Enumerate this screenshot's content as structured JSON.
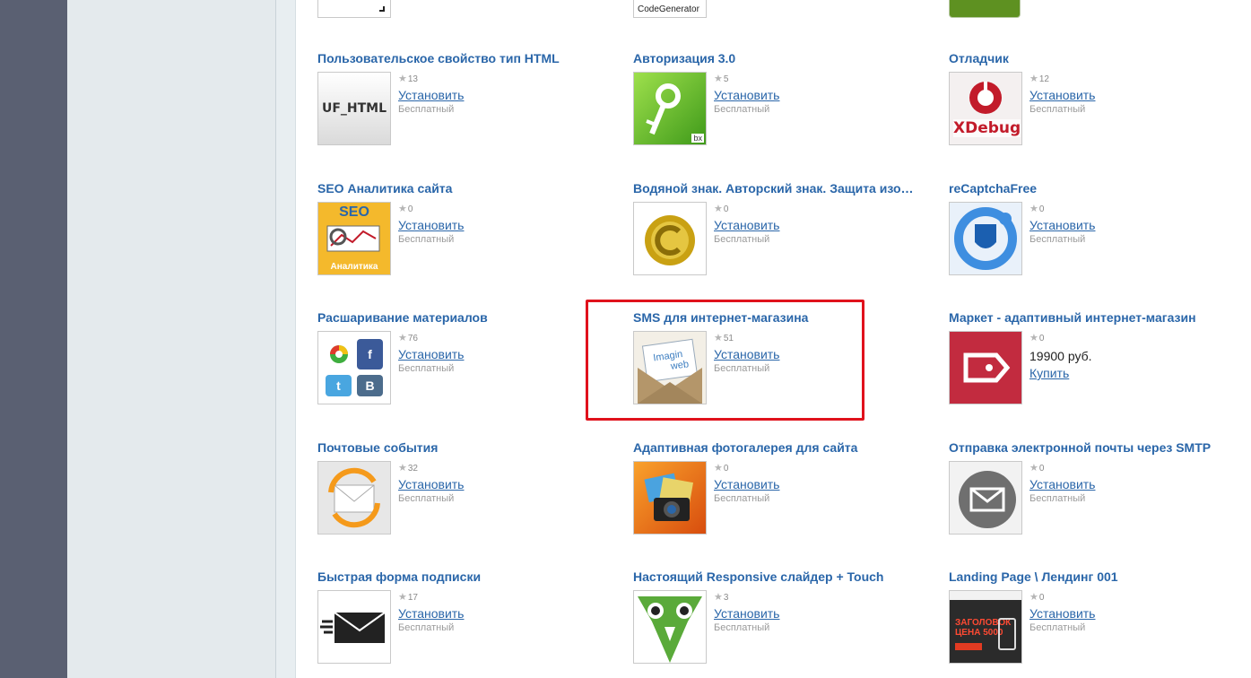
{
  "top_partial": {
    "codegen_label": "CodeGenerator"
  },
  "modules": [
    {
      "title": "Пользовательское свойство тип HTML",
      "rating": "13",
      "action": "Установить",
      "price": "Бесплатный",
      "thumb_text": "UF_HTML"
    },
    {
      "title": "Авторизация 3.0",
      "rating": "5",
      "action": "Установить",
      "price": "Бесплатный",
      "thumb_text": "bx"
    },
    {
      "title": "Отладчик",
      "rating": "12",
      "action": "Установить",
      "price": "Бесплатный",
      "thumb_text": "XDebug"
    },
    {
      "title": "SEO Аналитика сайта",
      "rating": "0",
      "action": "Установить",
      "price": "Бесплатный",
      "thumb_text": "SEO",
      "thumb_subtext": "Аналитика"
    },
    {
      "title": "Водяной знак. Авторский знак. Защита изображений",
      "rating": "0",
      "action": "Установить",
      "price": "Бесплатный"
    },
    {
      "title": "reCaptchaFree",
      "rating": "0",
      "action": "Установить",
      "price": "Бесплатный"
    },
    {
      "title": "Расшаривание материалов",
      "rating": "76",
      "action": "Установить",
      "price": "Бесплатный",
      "thumb_text": "B"
    },
    {
      "title": "SMS для интернет-магазина",
      "rating": "51",
      "action": "Установить",
      "price": "Бесплатный",
      "thumb_text": "Imagin web"
    },
    {
      "title": "Маркет - адаптивный интернет-магазин",
      "rating": "0",
      "price_value": "19900 руб.",
      "action": "Купить"
    },
    {
      "title": "Почтовые события",
      "rating": "32",
      "action": "Установить",
      "price": "Бесплатный"
    },
    {
      "title": "Адаптивная фотогалерея для сайта",
      "rating": "0",
      "action": "Установить",
      "price": "Бесплатный"
    },
    {
      "title": "Отправка электронной почты через SMTP",
      "rating": "0",
      "action": "Установить",
      "price": "Бесплатный"
    },
    {
      "title": "Быстрая форма подписки",
      "rating": "17",
      "action": "Установить",
      "price": "Бесплатный"
    },
    {
      "title": "Настоящий Responsive слайдер + Touch",
      "rating": "3",
      "action": "Установить",
      "price": "Бесплатный"
    },
    {
      "title": "Landing Page \\ Лендинг 001",
      "rating": "0",
      "action": "Установить",
      "price": "Бесплатный",
      "thumb_text": "ЗАГОЛОВОК ЦЕНА 5000"
    }
  ],
  "colors": {
    "link": "#2a66a9",
    "highlight": "#e0121c",
    "rail": "#5a6072",
    "sidebar": "#e4eaed"
  }
}
